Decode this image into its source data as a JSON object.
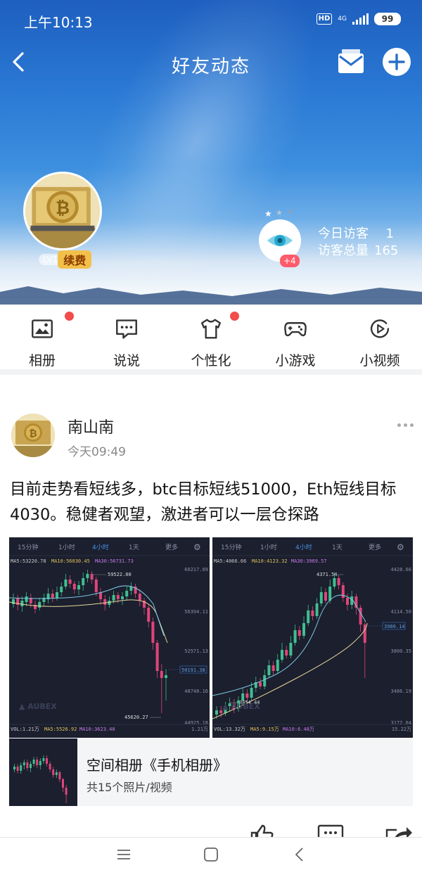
{
  "status_bar": {
    "time": "上午10:13",
    "hd": "HD",
    "network": "4G",
    "battery": "99"
  },
  "header": {
    "title": "好友动态"
  },
  "profile": {
    "level": "LV1",
    "renew": "续费",
    "visitor_badge": "+4",
    "today_label": "今日访客",
    "today_count": "1",
    "total_label": "访客总量",
    "total_count": "165"
  },
  "features": [
    {
      "label": "相册",
      "icon": "photo-album-icon",
      "dot": true
    },
    {
      "label": "说说",
      "icon": "chat-bubble-icon",
      "dot": false
    },
    {
      "label": "个性化",
      "icon": "tshirt-icon",
      "dot": true
    },
    {
      "label": "小游戏",
      "icon": "gamepad-icon",
      "dot": false
    },
    {
      "label": "小视频",
      "icon": "play-video-icon",
      "dot": false
    }
  ],
  "post": {
    "author": "南山南",
    "time": "今天09:49",
    "text": "目前走势看短线多，btc目标短线51000，Eth短线目标4030。稳健者观望，激进者可以一层仓探路",
    "chart1": {
      "tabs": [
        "15分钟",
        "1小时",
        "4小时",
        "1天",
        "更多"
      ],
      "ma": [
        "MA5:53220.78",
        "MA10:56030.45",
        "MA30:56731.73"
      ],
      "prices": [
        "60217.09",
        "56394.11",
        "52571.13",
        "48748.16",
        "44925.18"
      ],
      "marks": [
        "59522.00",
        "50191.38",
        "45620.27"
      ],
      "vol": [
        "VOL:1.21万",
        "MA5:5526.92",
        "MA10:3623.40",
        "1.21万"
      ]
    },
    "chart2": {
      "tabs": [
        "15分钟",
        "1小时",
        "4小时",
        "1天",
        "更多"
      ],
      "ma": [
        "MA5:4066.66",
        "MA10:4123.32",
        "MA30:3969.57"
      ],
      "prices": [
        "4428.66",
        "4114.50",
        "3800.35",
        "3486.19",
        "3172.04"
      ],
      "marks": [
        "4371.54",
        "3980.14",
        "3354.44"
      ],
      "vol": [
        "VOL:13.32万",
        "MA5:9.15万",
        "MA10:6.48万",
        "15.22万"
      ]
    },
    "album": {
      "title": "空间相册《手机相册》",
      "subtitle": "共15个照片/视频"
    }
  }
}
